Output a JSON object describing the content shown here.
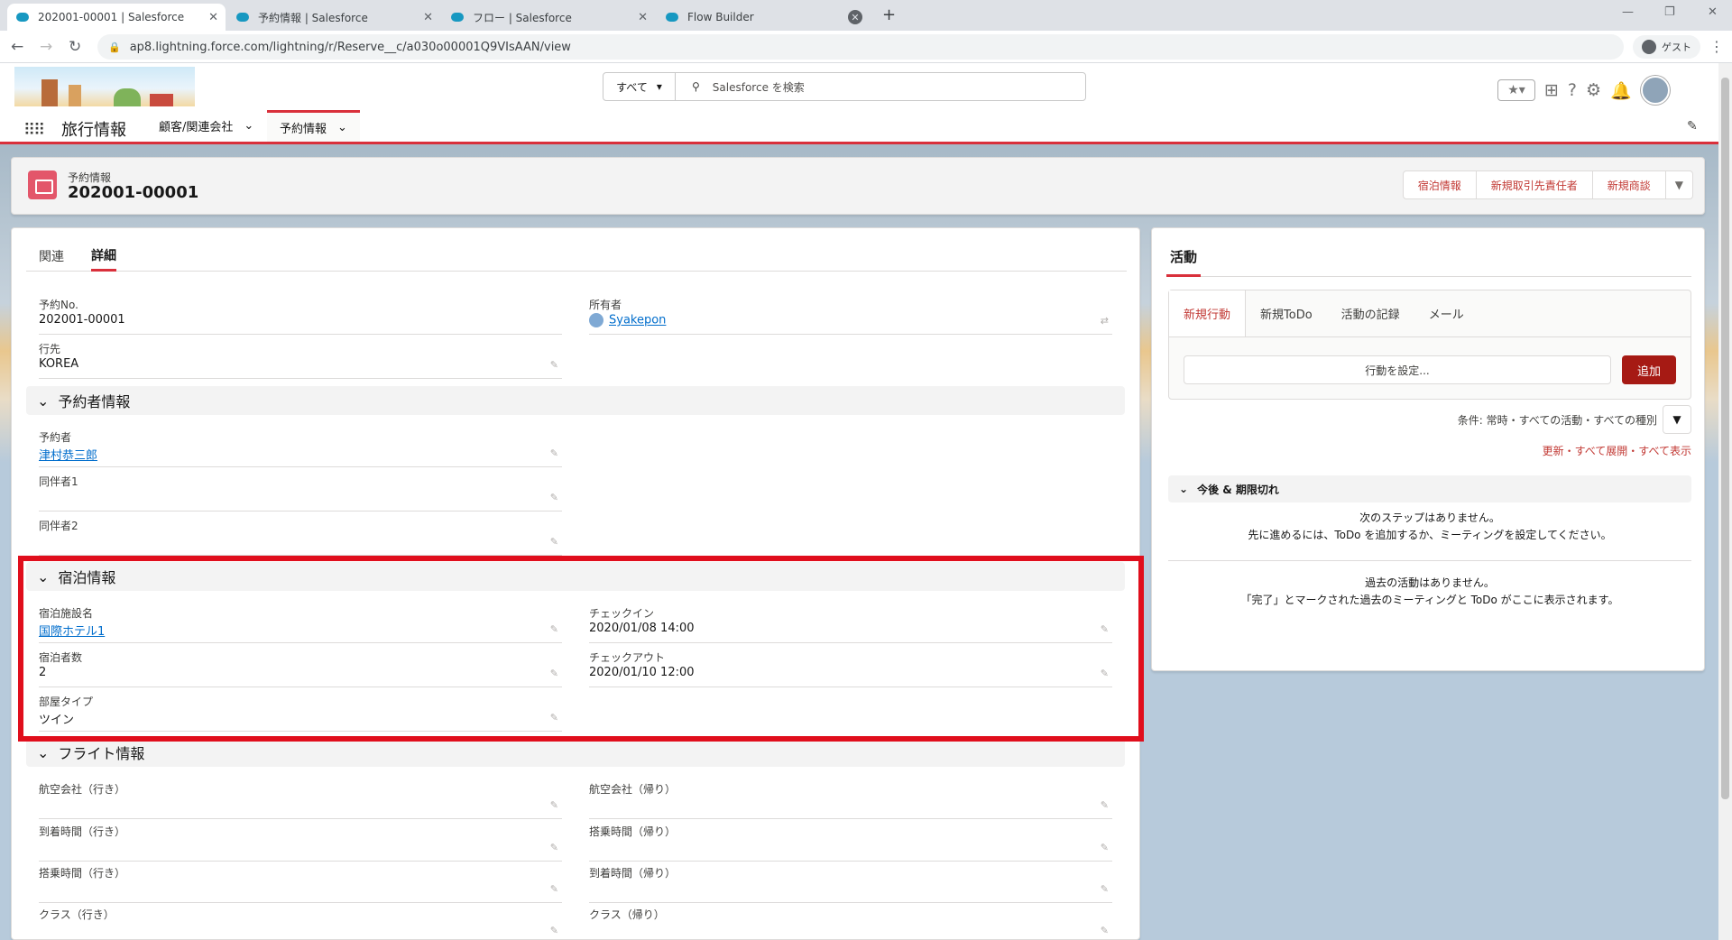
{
  "browser": {
    "tabs": [
      {
        "title": "202001-00001 | Salesforce"
      },
      {
        "title": "予約情報 | Salesforce"
      },
      {
        "title": "フロー | Salesforce"
      },
      {
        "title": "Flow Builder"
      }
    ],
    "url": "ap8.lightning.force.com/lightning/r/Reserve__c/a030o00001Q9VIsAAN/view",
    "guest_label": "ゲスト"
  },
  "header": {
    "search_scope": "すべて",
    "search_placeholder": "Salesforce を検索"
  },
  "appnav": {
    "app_name": "旅行情報",
    "items": [
      {
        "label": "顧客/関連会社"
      },
      {
        "label": "予約情報"
      }
    ]
  },
  "record": {
    "type_label": "予約情報",
    "title": "202001-00001",
    "actions": [
      "宿泊情報",
      "新規取引先責任者",
      "新規商談",
      "▼"
    ]
  },
  "detail": {
    "tabs": [
      "関連",
      "詳細"
    ],
    "fields_top": [
      {
        "label": "予約No.",
        "value": "202001-00001"
      },
      {
        "label": "所有者",
        "value": "Syakepon"
      },
      {
        "label": "行先",
        "value": "KOREA"
      }
    ],
    "sections": {
      "reserver": "予約者情報",
      "stay": "宿泊情報",
      "flight": "フライト情報"
    },
    "reserver_fields": [
      {
        "label": "予約者",
        "value": "津村恭三郎"
      },
      {
        "label": "同伴者1",
        "value": ""
      },
      {
        "label": "同伴者2",
        "value": ""
      }
    ],
    "stay_fields": [
      {
        "label": "宿泊施設名",
        "value": "国際ホテル1"
      },
      {
        "label": "チェックイン",
        "value": "2020/01/08 14:00"
      },
      {
        "label": "宿泊者数",
        "value": "2"
      },
      {
        "label": "チェックアウト",
        "value": "2020/01/10 12:00"
      },
      {
        "label": "部屋タイプ",
        "value": "ツイン"
      }
    ],
    "flight_fields": [
      {
        "label": "航空会社（行き）"
      },
      {
        "label": "航空会社（帰り）"
      },
      {
        "label": "到着時間（行き）"
      },
      {
        "label": "搭乗時間（帰り）"
      },
      {
        "label": "搭乗時間（行き）"
      },
      {
        "label": "到着時間（帰り）"
      },
      {
        "label": "クラス（行き）"
      },
      {
        "label": "クラス（帰り）"
      }
    ]
  },
  "activity": {
    "title": "活動",
    "publisher_tabs": [
      "新規行動",
      "新規ToDo",
      "活動の記録",
      "メール"
    ],
    "input_placeholder": "行動を設定...",
    "add_button": "追加",
    "filter_text": "条件: 常時・すべての活動・すべての種別",
    "links": "更新・すべて展開・すべて表示",
    "upcoming_title": "今後 & 期限切れ",
    "no_next_1": "次のステップはありません。",
    "no_next_2": "先に進めるには、ToDo を追加するか、ミーティングを設定してください。",
    "no_past_1": "過去の活動はありません。",
    "no_past_2": "「完了」とマークされた過去のミーティングと ToDo がここに表示されます。"
  },
  "colors": {
    "accent": "#d9303b",
    "link": "#006dcc",
    "highlight": "#e00e1c",
    "add_button": "#a61a14"
  }
}
